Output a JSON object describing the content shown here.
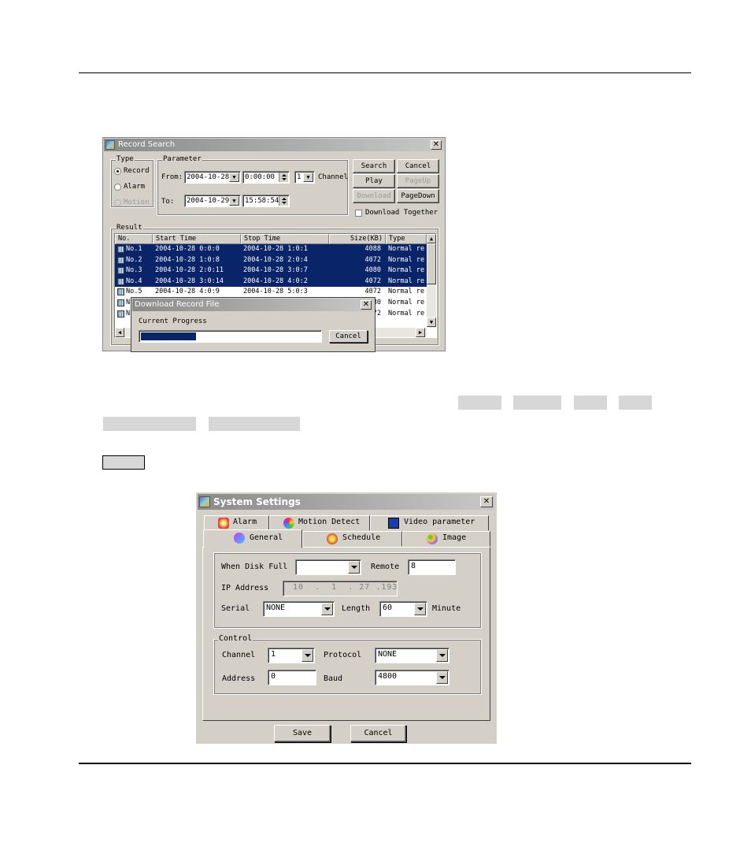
{
  "record_search": {
    "title": "Record Search",
    "type_group": "Type",
    "type_options": [
      "Record",
      "Alarm",
      "Motion"
    ],
    "parameter_group": "Parameter",
    "from_label": "From:",
    "from_date": "2004-10-28",
    "from_time": "0:00:00",
    "channel_value": "1",
    "channel_label": "Channel",
    "to_label": "To:",
    "to_date": "2004-10-29",
    "to_time": "15:58:54",
    "buttons": {
      "search": "Search",
      "cancel": "Cancel",
      "play": "Play",
      "pageup": "PageUp",
      "download": "Download",
      "pagedown": "PageDown"
    },
    "download_together": "Download Together",
    "result_group": "Result",
    "columns": [
      "No.",
      "Start Time",
      "Stop Time",
      "Size(KB)",
      "Type"
    ],
    "rows": [
      {
        "no": "No.1",
        "start": "2004-10-28 0:0:0",
        "stop": "2004-10-28 1:0:1",
        "size": "4088",
        "type": "Normal re"
      },
      {
        "no": "No.2",
        "start": "2004-10-28 1:0:8",
        "stop": "2004-10-28 2:0:4",
        "size": "4072",
        "type": "Normal re"
      },
      {
        "no": "No.3",
        "start": "2004-10-28 2:0:11",
        "stop": "2004-10-28 3:0:7",
        "size": "4080",
        "type": "Normal re"
      },
      {
        "no": "No.4",
        "start": "2004-10-28 3:0:14",
        "stop": "2004-10-28 4:0:2",
        "size": "4072",
        "type": "Normal re"
      },
      {
        "no": "No.5",
        "start": "2004-10-28 4:0:9",
        "stop": "2004-10-28 5:0:3",
        "size": "4072",
        "type": "Normal re"
      },
      {
        "no": "N",
        "start": "",
        "stop": "",
        "size": "80",
        "type": "Normal re"
      },
      {
        "no": "N",
        "start": "",
        "stop": "",
        "size": "72",
        "type": "Normal re"
      }
    ],
    "colors": {
      "selection": "#0a246a",
      "titlebar": "#9a9a9a"
    }
  },
  "download_dialog": {
    "title": "Download Record File",
    "progress_label": "Current Progress",
    "progress_fraction": 0.31,
    "cancel": "Cancel",
    "colors": {
      "progress": "#0a246a"
    }
  },
  "system_settings": {
    "title": "System Settings",
    "tabs_back": [
      {
        "label": "Alarm",
        "icon": "alarm-icon"
      },
      {
        "label": "Motion Detect",
        "icon": "motion-detect-icon"
      },
      {
        "label": "Video parameter",
        "icon": "video-parameter-icon"
      }
    ],
    "tabs_front": [
      {
        "label": "General",
        "icon": "general-icon"
      },
      {
        "label": "Schedule",
        "icon": "schedule-icon"
      },
      {
        "label": "Image",
        "icon": "image-icon"
      }
    ],
    "when_disk_full_label": "When Disk Full",
    "when_disk_full_value": "",
    "remote_label": "Remote",
    "remote_value": "8",
    "ip_label": "IP Address",
    "ip_parts": [
      "10",
      "1",
      "27",
      "193"
    ],
    "serial_label": "Serial",
    "serial_value": "NONE",
    "length_label": "Length",
    "length_value": "60",
    "minute_label": "Minute",
    "control_group": "Control",
    "channel_label": "Channel",
    "channel_value": "1",
    "protocol_label": "Protocol",
    "protocol_value": "NONE",
    "address_label": "Address",
    "address_value": "0",
    "baud_label": "Baud",
    "baud_value": "4800",
    "save": "Save",
    "cancel": "Cancel"
  }
}
